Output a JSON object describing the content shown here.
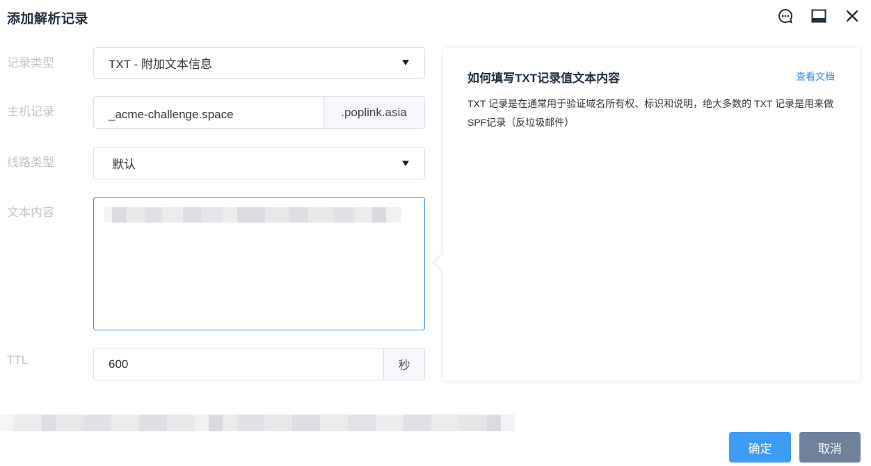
{
  "dialog": {
    "title": "添加解析记录"
  },
  "form": {
    "record_type": {
      "label": "记录类型",
      "value": "TXT - 附加文本信息"
    },
    "host": {
      "label": "主机记录",
      "value": "_acme-challenge.space",
      "suffix": ".poplink.asia"
    },
    "line_type": {
      "label": "线路类型",
      "value": "默认"
    },
    "text_content": {
      "label": "文本内容"
    },
    "ttl": {
      "label": "TTL",
      "value": "600",
      "unit": "秒"
    }
  },
  "help": {
    "title": "如何填写TXT记录值文本内容",
    "link": "查看文档",
    "body": "TXT 记录是在通常用于验证域名所有权、标识和说明，绝大多数的 TXT 记录是用来做SPF记录（反垃圾邮件）"
  },
  "buttons": {
    "confirm": "确定",
    "cancel": "取消"
  },
  "colors": {
    "primary": "#3d9cf5",
    "cancel": "#6e829e",
    "link": "#3a8ee6"
  },
  "icons": [
    "feedback-icon",
    "minimize-icon",
    "close-icon"
  ]
}
